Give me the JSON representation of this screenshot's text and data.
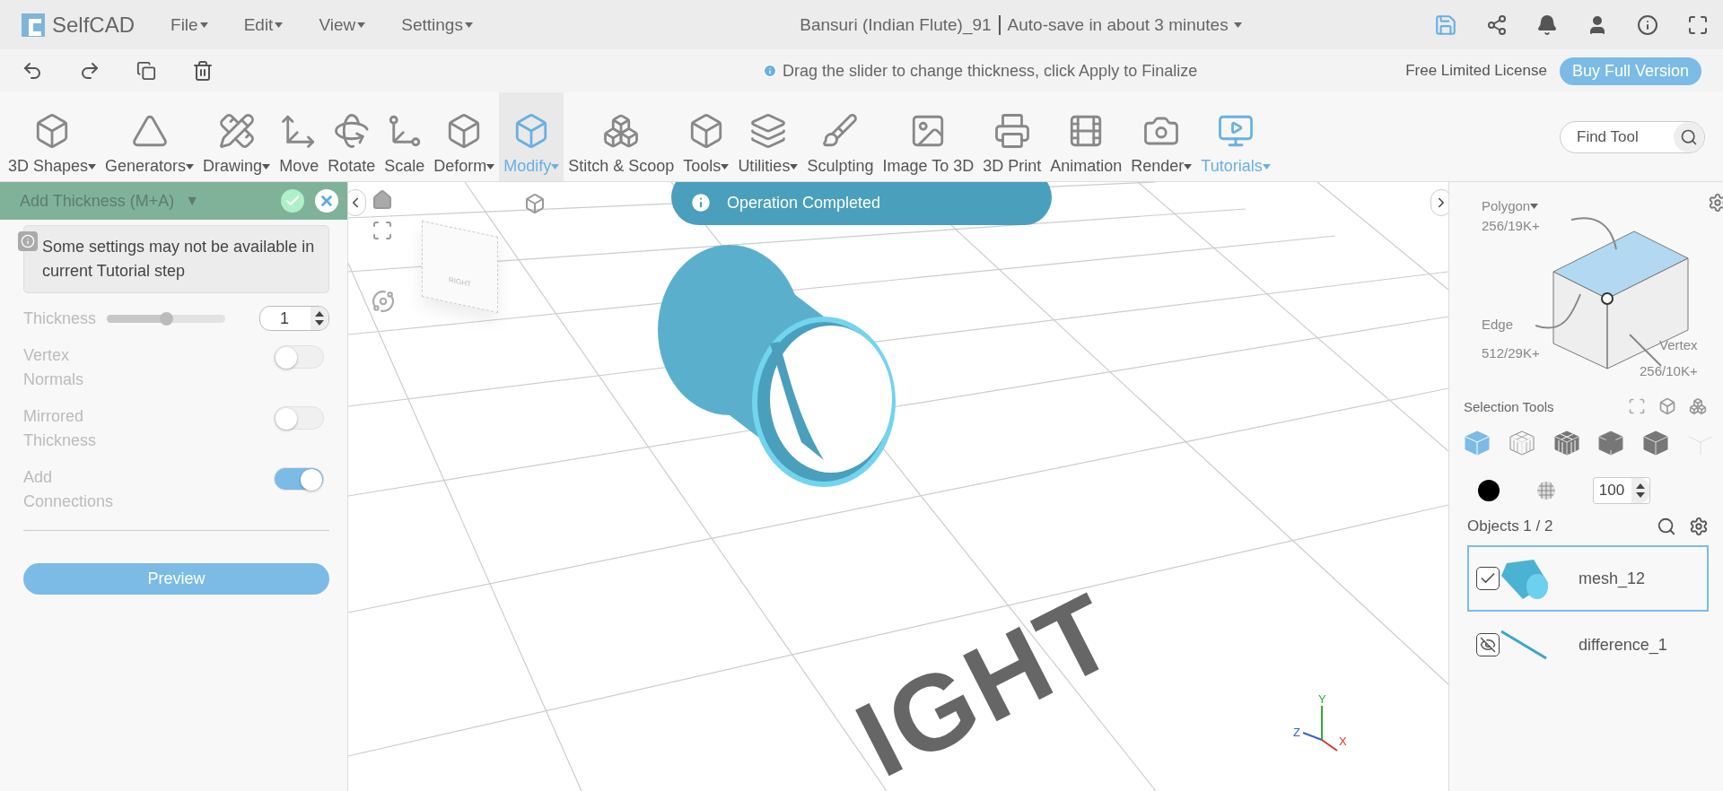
{
  "app": {
    "logo": "SelfCAD",
    "menus": [
      {
        "label": "File"
      },
      {
        "label": "Edit"
      },
      {
        "label": "View"
      },
      {
        "label": "Settings"
      }
    ],
    "document_title": "Bansuri (Indian Flute)_91",
    "autosave": "Auto-save in about 3 minutes"
  },
  "hint": "Drag the slider to change thickness, click Apply to Finalize",
  "license": "Free Limited License",
  "buy_button": "Buy Full Version",
  "tools": [
    {
      "label": "3D Shapes",
      "dropdown": true,
      "selected": false,
      "accent": false
    },
    {
      "label": "Generators",
      "dropdown": true,
      "selected": false,
      "accent": false
    },
    {
      "label": "Drawing",
      "dropdown": true,
      "selected": false,
      "accent": false
    },
    {
      "label": "Move",
      "dropdown": false,
      "selected": false,
      "accent": false
    },
    {
      "label": "Rotate",
      "dropdown": false,
      "selected": false,
      "accent": false
    },
    {
      "label": "Scale",
      "dropdown": false,
      "selected": false,
      "accent": false
    },
    {
      "label": "Deform",
      "dropdown": true,
      "selected": false,
      "accent": false
    },
    {
      "label": "Modify",
      "dropdown": true,
      "selected": true,
      "accent": true
    },
    {
      "label": "Stitch & Scoop",
      "dropdown": false,
      "selected": false,
      "accent": false
    },
    {
      "label": "Tools",
      "dropdown": true,
      "selected": false,
      "accent": false
    },
    {
      "label": "Utilities",
      "dropdown": true,
      "selected": false,
      "accent": false
    },
    {
      "label": "Sculpting",
      "dropdown": false,
      "selected": false,
      "accent": false
    },
    {
      "label": "Image To 3D",
      "dropdown": false,
      "selected": false,
      "accent": false
    },
    {
      "label": "3D Print",
      "dropdown": false,
      "selected": false,
      "accent": false
    },
    {
      "label": "Animation",
      "dropdown": false,
      "selected": false,
      "accent": false
    },
    {
      "label": "Render",
      "dropdown": true,
      "selected": false,
      "accent": false
    },
    {
      "label": "Tutorials",
      "dropdown": true,
      "selected": false,
      "accent": true
    }
  ],
  "find_tool": {
    "placeholder": "Find Tool"
  },
  "panel": {
    "title": "Add Thickness (M+A)",
    "caret": "▼",
    "note": "Some settings may not be available in current Tutorial step",
    "thickness": {
      "label": "Thickness",
      "level": 0.5,
      "value": "1"
    },
    "toggles": [
      {
        "label": "Vertex Normals",
        "on": false
      },
      {
        "label": "Mirrored Thickness",
        "on": false
      },
      {
        "label": "Add Connections",
        "on": true
      }
    ],
    "preview": "Preview"
  },
  "toast": "Operation Completed",
  "viewport": {
    "cube_label": "RIGHT",
    "floor_label": "IGHT",
    "axes": [
      "Y",
      "Z",
      "X"
    ]
  },
  "selection": {
    "polygon_label": "Polygon",
    "polygon_count": "256/19K+",
    "edge_label": "Edge",
    "edge_count": "512/29K+",
    "vertex_label": "Vertex",
    "vertex_count": "256/10K+",
    "title": "Selection Tools",
    "modes": [
      {
        "selected": true
      },
      {
        "selected": false
      },
      {
        "selected": false
      },
      {
        "selected": false
      },
      {
        "selected": false
      },
      {
        "selected": false
      }
    ],
    "opacity": "100"
  },
  "objects": {
    "title": "Objects 1 / 2",
    "items": [
      {
        "name": "mesh_12",
        "kind": "mesh",
        "selected": true,
        "visible": true
      },
      {
        "name": "difference_1",
        "kind": "line",
        "selected": false,
        "visible": false
      }
    ]
  }
}
